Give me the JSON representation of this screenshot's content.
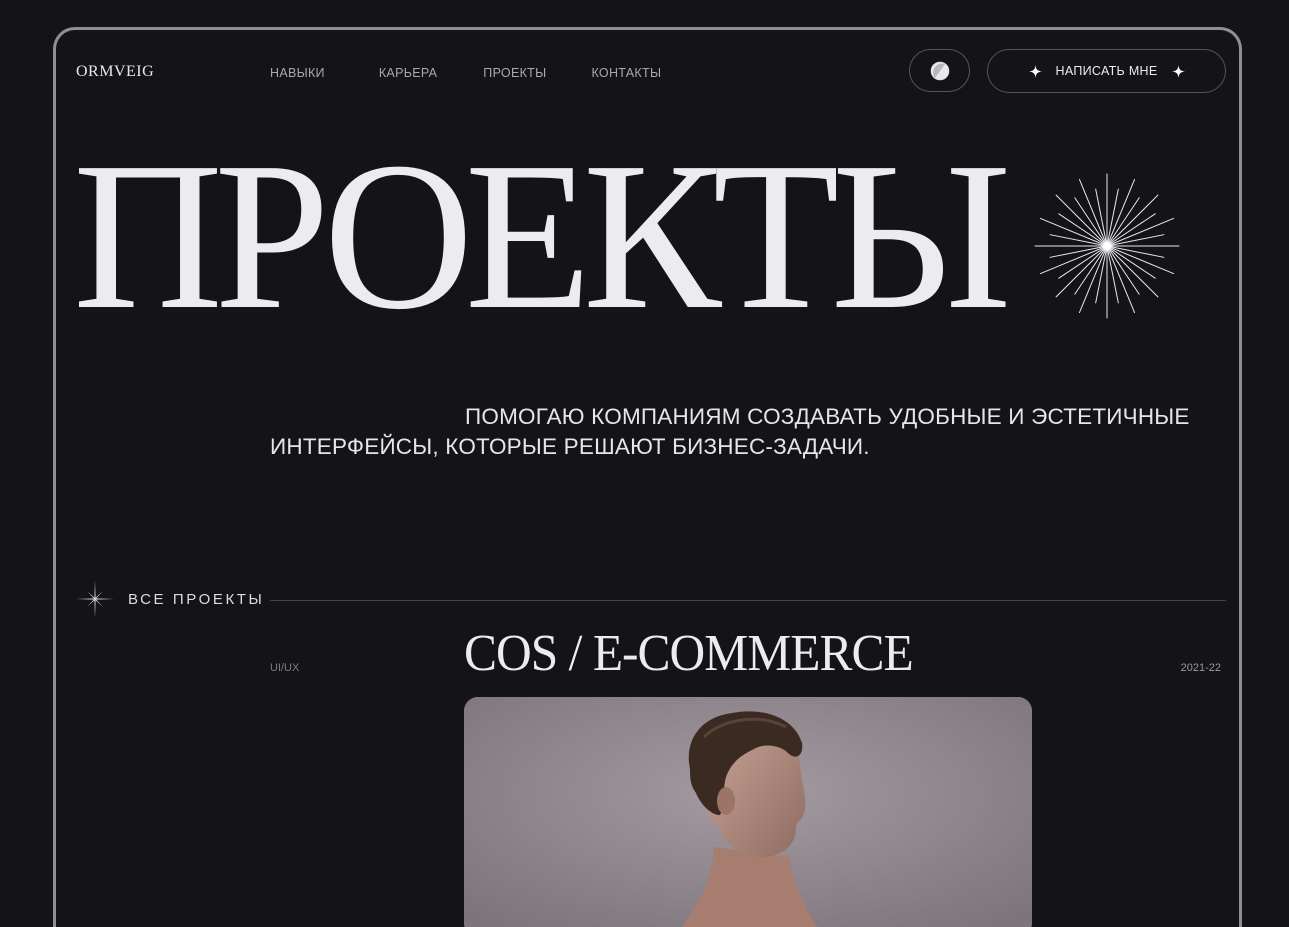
{
  "header": {
    "logo": "ORMVEIG",
    "nav": [
      "НАВЫКИ",
      "КАРЬЕРА",
      "ПРОЕКТЫ",
      "КОНТАКТЫ"
    ],
    "theme_toggle_icon": "half-moon-icon",
    "contact_button": "НАПИСАТЬ МНЕ"
  },
  "hero": {
    "title": "ПРОЕКТЫ",
    "lead": "ПОМОГАЮ КОМПАНИЯМ СОЗДАВАТЬ УДОБНЫЕ И ЭСТЕТИЧНЫЕ ИНТЕРФЕЙСЫ, КОТОРЫЕ РЕШАЮТ БИЗНЕС-ЗАДАЧИ."
  },
  "section": {
    "label": "ВСЕ ПРОЕКТЫ"
  },
  "project": {
    "tag": "UI/UX",
    "title": "COS / E-COMMERCE",
    "year": "2021-22"
  },
  "colors": {
    "background": "#141318",
    "frame_border": "#8f8e94",
    "text": "#ecebee",
    "muted": "#a9a8ae"
  }
}
